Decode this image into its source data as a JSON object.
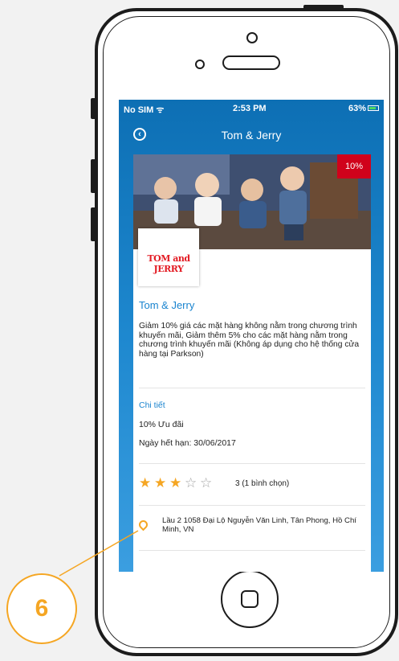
{
  "status_bar": {
    "carrier": "No SIM ᯤ",
    "time": "2:53 PM",
    "battery": "63%"
  },
  "nav": {
    "title": "Tom & Jerry",
    "back_icon": "chevron-left-circle-icon"
  },
  "promo": {
    "badge": "10%",
    "logo_text": "TOM and JERRY",
    "shop_name": "Tom & Jerry",
    "description": "Giảm 10% giá các mặt hàng không nằm trong chương trình khuyến mãi, Giảm thêm 5% cho các mặt hàng nằm trong chương trình khuyến mãi (Không áp dụng cho hệ thống cửa hàng tại Parkson)",
    "details_link": "Chi tiết",
    "offer": "10% Ưu đãi",
    "expiry": "Ngày hết hạn: 30/06/2017",
    "rating": {
      "value": 3,
      "max": 5,
      "text": "3 (1 bình chọn)"
    },
    "address": "Lầu 2 1058 Đại Lộ Nguyễn Văn Linh, Tân Phong, Hồ Chí Minh, VN",
    "address_icon": "map-pin-icon"
  },
  "callout": {
    "number": "6"
  },
  "colors": {
    "accent_blue": "#1a84cf",
    "badge_red": "#d0021b",
    "star_orange": "#f5a623",
    "callout_orange": "#f5a623"
  }
}
